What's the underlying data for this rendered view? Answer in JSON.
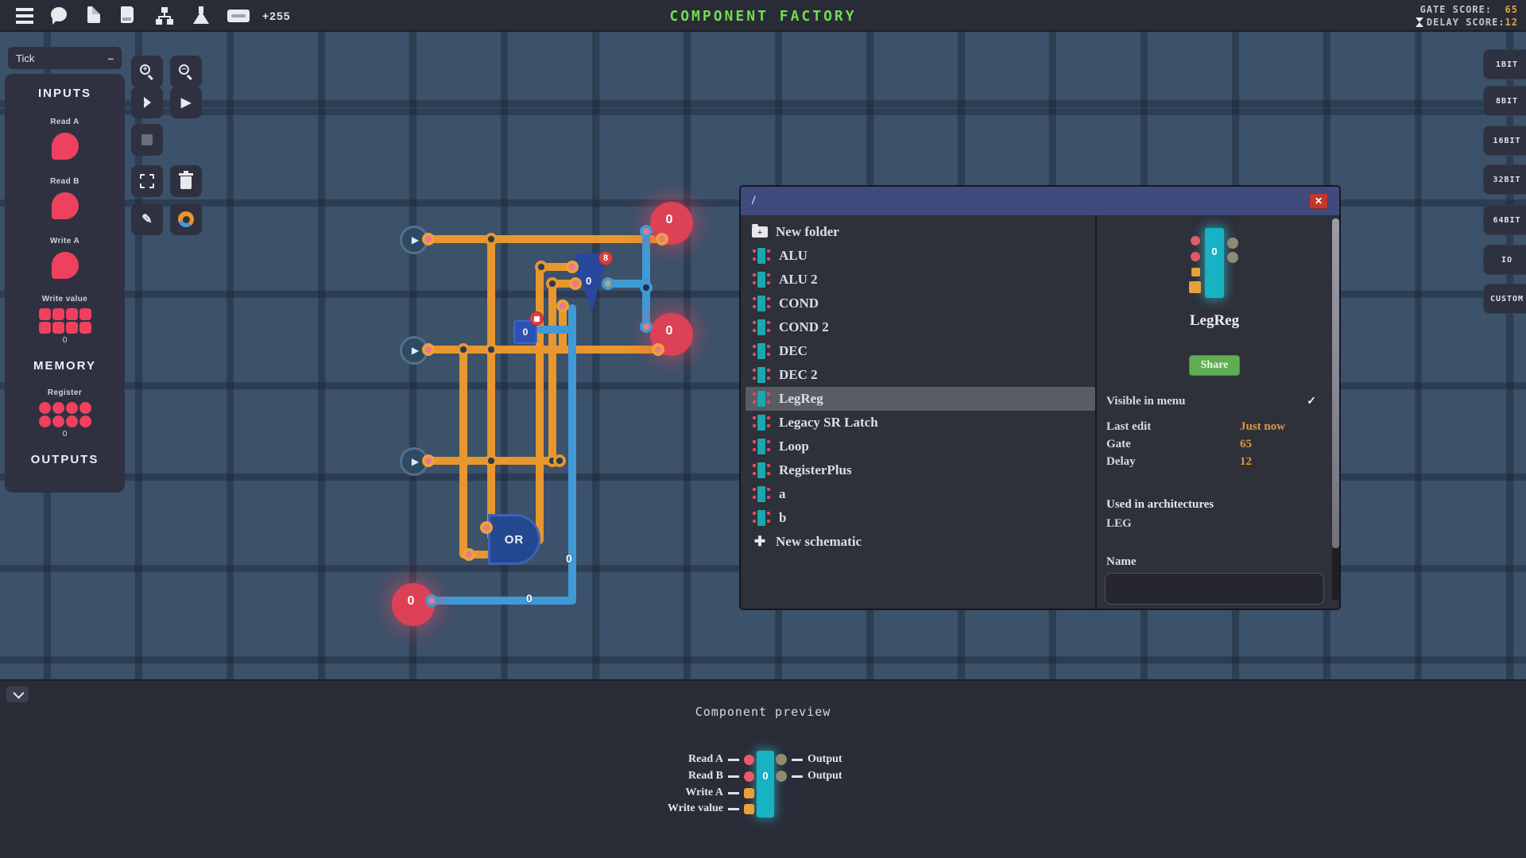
{
  "topbar": {
    "title": "COMPONENT FACTORY",
    "counter": "+255",
    "gate_score_label": "GATE SCORE:",
    "gate_score": "65",
    "delay_score_label": "DELAY SCORE:",
    "delay_score": "12"
  },
  "toolbar": {
    "tick_label": "Tick",
    "tick_collapse": "–",
    "zoom_in": "+",
    "zoom_out": "−",
    "or_label": "OR"
  },
  "palette": {
    "inputs_heading": "INPUTS",
    "memory_heading": "MEMORY",
    "outputs_heading": "OUTPUTS",
    "items": [
      {
        "label": "Read A"
      },
      {
        "label": "Read B"
      },
      {
        "label": "Write A"
      },
      {
        "label": "Write value",
        "value": "0"
      }
    ],
    "memory_items": [
      {
        "label": "Register",
        "value": "0"
      }
    ]
  },
  "bit_tabs": [
    "1BIT",
    "8BIT",
    "16BIT",
    "32BIT",
    "64BIT",
    "IO",
    "CUSTOM"
  ],
  "canvas": {
    "or_gate_label": "OR",
    "wedge_gate_value": "0",
    "wedge_badge": "8",
    "square_gate_value": "0",
    "node_values": {
      "out1": "0",
      "out2": "0",
      "out3": "0"
    },
    "wire_values": [
      "0",
      "0"
    ]
  },
  "dialog": {
    "path": "/",
    "close_glyph": "✕",
    "list": [
      {
        "label": "New folder"
      },
      {
        "label": "ALU"
      },
      {
        "label": "ALU 2"
      },
      {
        "label": "COND"
      },
      {
        "label": "COND 2"
      },
      {
        "label": "DEC"
      },
      {
        "label": "DEC 2"
      },
      {
        "label": "LegReg"
      },
      {
        "label": "Legacy SR Latch"
      },
      {
        "label": "Loop"
      },
      {
        "label": "RegisterPlus"
      },
      {
        "label": "a"
      },
      {
        "label": "b"
      },
      {
        "label": "New schematic"
      }
    ],
    "new_folder_plus": "+",
    "new_schematic_plus": "✚",
    "selected": "LegReg",
    "details": {
      "name": "LegReg",
      "preview_value": "0",
      "share_label": "Share",
      "visible_label": "Visible in menu",
      "visible_check": "✓",
      "last_edit_label": "Last edit",
      "last_edit_value": "Just now",
      "gate_label": "Gate",
      "gate_value": "65",
      "delay_label": "Delay",
      "delay_value": "12",
      "used_heading": "Used in architectures",
      "used_value": "LEG",
      "name_label": "Name",
      "name_input_value": ""
    }
  },
  "preview": {
    "heading": "Component preview",
    "value": "0",
    "left_ports": [
      {
        "label": "Read A"
      },
      {
        "label": "Read B"
      },
      {
        "label": "Write A"
      },
      {
        "label": "Write value"
      }
    ],
    "right_ports": [
      {
        "label": "Output"
      },
      {
        "label": "Output"
      }
    ]
  }
}
